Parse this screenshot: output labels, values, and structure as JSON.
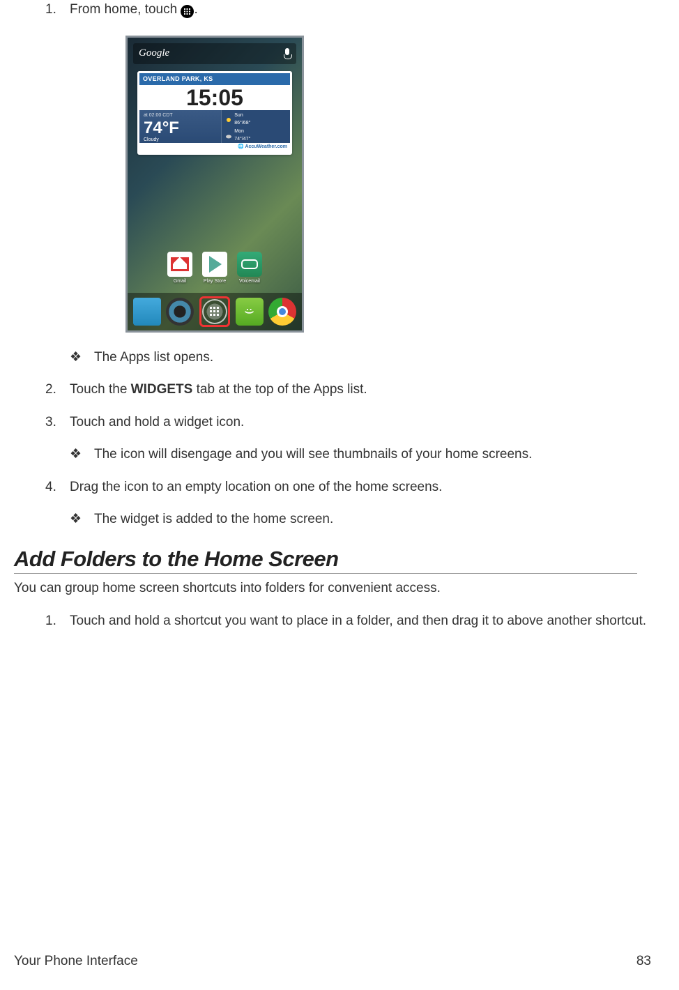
{
  "step1": {
    "num": "1.",
    "text_before": "From home, touch ",
    "text_after": "."
  },
  "screenshot": {
    "search_brand": "Google",
    "weather": {
      "location": "OVERLAND PARK, KS",
      "time": "15:05",
      "subtime": "at 02:00 CDT",
      "temp": "74°F",
      "condition": "Cloudy",
      "forecast": [
        {
          "day": "Sun",
          "hi_lo": "86°/68°"
        },
        {
          "day": "Mon",
          "hi_lo": "74°/47°"
        }
      ],
      "provider": "AccuWeather.com"
    },
    "apps": [
      {
        "label": "Gmail"
      },
      {
        "label": "Play Store"
      },
      {
        "label": "Voicemail"
      }
    ]
  },
  "step1_sub": {
    "bullet": "❖",
    "text": "The Apps list opens."
  },
  "step2": {
    "num": "2.",
    "text_before": "Touch the ",
    "bold": "WIDGETS",
    "text_after": " tab at the top of the Apps list."
  },
  "step3": {
    "num": "3.",
    "text": "Touch and hold a widget icon.",
    "sub_bullet": "❖",
    "sub_text": "The icon will disengage and you will see thumbnails of your home screens."
  },
  "step4": {
    "num": "4.",
    "text": "Drag the icon to an empty location on one of the home screens.",
    "sub_bullet": "❖",
    "sub_text": "The widget is added to the home screen."
  },
  "heading": "Add Folders to the Home Screen",
  "heading_desc": "You can group home screen shortcuts into folders for convenient access.",
  "folders_step1": {
    "num": "1.",
    "text": "Touch and hold a shortcut you want to place in a folder, and then drag it to above another shortcut."
  },
  "footer": {
    "section": "Your Phone Interface",
    "page": "83"
  }
}
